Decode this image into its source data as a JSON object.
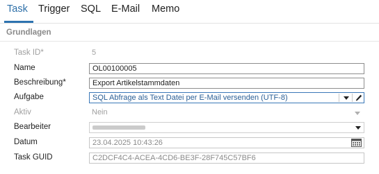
{
  "tabs": [
    {
      "label": "Task",
      "active": true
    },
    {
      "label": "Trigger",
      "active": false
    },
    {
      "label": "SQL",
      "active": false
    },
    {
      "label": "E-Mail",
      "active": false
    },
    {
      "label": "Memo",
      "active": false
    }
  ],
  "section": {
    "title": "Grundlagen"
  },
  "fields": {
    "task_id": {
      "label": "Task ID*",
      "value": "5"
    },
    "name": {
      "label": "Name",
      "value": "OL00100005"
    },
    "beschreibung": {
      "label": "Beschreibung*",
      "value": "Export Artikelstammdaten"
    },
    "aufgabe": {
      "label": "Aufgabe",
      "value": "SQL Abfrage als Text Datei per E-Mail versenden (UTF-8)"
    },
    "aktiv": {
      "label": "Aktiv",
      "value": "Nein"
    },
    "bearbeiter": {
      "label": "Bearbeiter",
      "value": ""
    },
    "datum": {
      "label": "Datum",
      "value": "23.04.2025 10:43:26"
    },
    "task_guid": {
      "label": "Task GUID",
      "value": "C2DCF4C4-ACEA-4CD6-BE3F-28F745C57BF6"
    }
  },
  "colors": {
    "accent": "#2d73b0",
    "selected_border": "#3a78b8"
  },
  "icons": {
    "edit": "pencil-icon",
    "calendar": "calendar-icon",
    "dropdown": "chevron-down-icon"
  }
}
